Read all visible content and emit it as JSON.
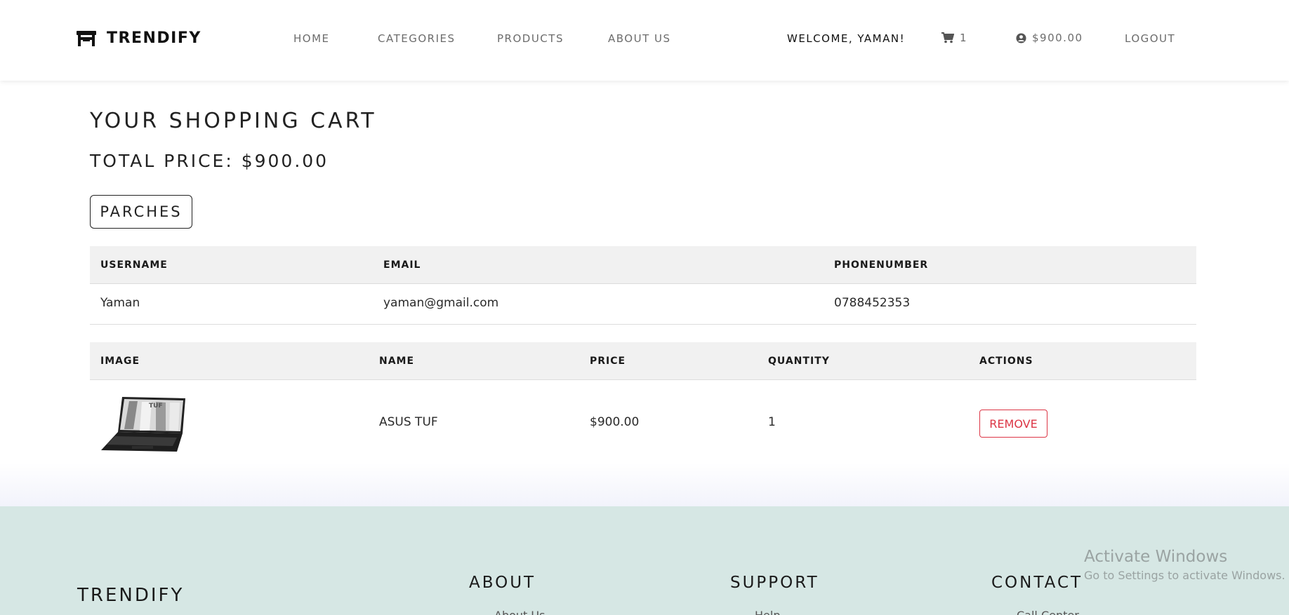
{
  "nav": {
    "brand": "TRENDIFY",
    "links": [
      "HOME",
      "CATEGORIES",
      "PRODUCTS",
      "ABOUT US"
    ],
    "welcome": "WELCOME, YAMAN!",
    "cart_count": "1",
    "balance": "$900.00",
    "logout": "LOGOUT"
  },
  "cart": {
    "title": "YOUR SHOPPING CART",
    "total_price": "TOTAL PRICE: $900.00",
    "purchase_label": "PARCHES"
  },
  "user_table": {
    "headers": [
      "USERNAME",
      "EMAIL",
      "PHONENUMBER"
    ],
    "row": [
      "Yaman",
      "yaman@gmail.com",
      "0788452353"
    ]
  },
  "product_table": {
    "headers": [
      "IMAGE",
      "NAME",
      "PRICE",
      "QUANTITY",
      "ACTIONS"
    ],
    "rows": [
      {
        "image": "laptop-image",
        "name": "ASUS TUF",
        "price": "$900.00",
        "quantity": "1",
        "action": "REMOVE"
      }
    ]
  },
  "footer": {
    "brand": "TRENDIFY",
    "sections": [
      {
        "title": "ABOUT",
        "first_link": "About Us"
      },
      {
        "title": "SUPPORT",
        "first_link": "Help"
      },
      {
        "title": "CONTACT",
        "first_link": "Call Center"
      }
    ]
  },
  "watermark": {
    "title": "Activate Windows",
    "subtitle": "Go to Settings to activate Windows."
  },
  "colors": {
    "accent_danger": "#dc3545",
    "footer_bg": "#d6e7e4",
    "table_header_bg": "#f1f1f1"
  }
}
